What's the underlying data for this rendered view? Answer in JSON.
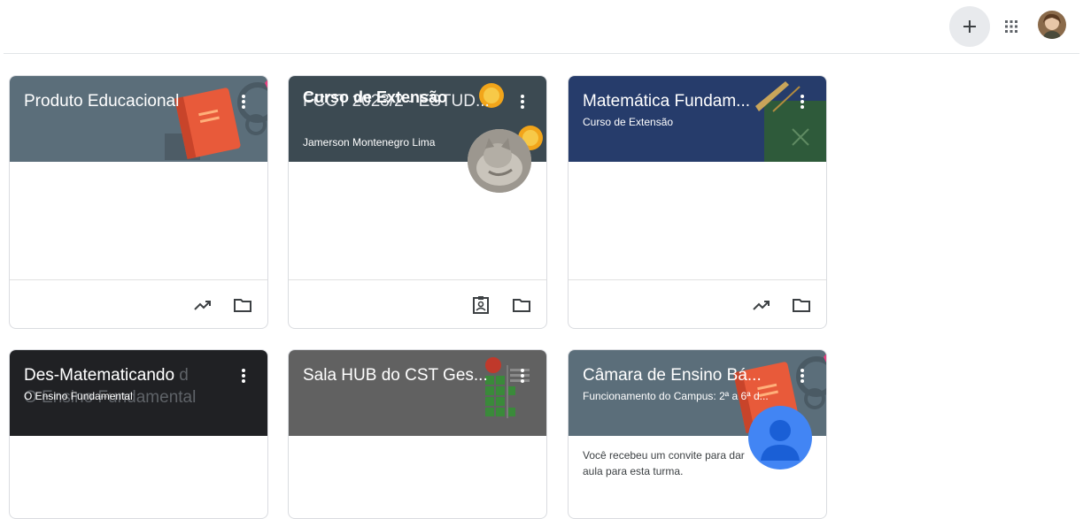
{
  "topbar": {
    "create_icon": "plus-icon",
    "apps_icon": "apps-grid-icon",
    "account_icon": "profile-avatar"
  },
  "cards": [
    {
      "title": "Produto Educacional",
      "subtitle": "",
      "teacher": "",
      "header_color": "#5b6e7a",
      "footer_icons": [
        "trending-up-icon",
        "folder-icon"
      ]
    },
    {
      "title": "FCCT 2023/2 - ESTUD...",
      "overlay_title": "Curso de Extensão",
      "subtitle": "",
      "teacher": "Jamerson Montenegro Lima",
      "header_color": "#3c4a52",
      "footer_icons": [
        "assignment-ind-icon",
        "folder-icon"
      ]
    },
    {
      "title": "Matemática Fundam...",
      "subtitle": "Curso de Extensão",
      "teacher": "",
      "header_color": "#263c6b",
      "footer_icons": [
        "trending-up-icon",
        "folder-icon"
      ]
    },
    {
      "title": "Des-Matematicando",
      "ghost_title": "Des-Matematicando d",
      "subtitle": "O Ensino Fundamental",
      "ghost_subtitle": "O Ensino Fundamental",
      "teacher": "",
      "header_color": "#202124",
      "footer_icons": []
    },
    {
      "title": "Sala HUB do CST Ges...",
      "subtitle": "",
      "teacher": "",
      "header_color": "#616161",
      "footer_icons": []
    },
    {
      "title": "Câmara de Ensino Bá...",
      "subtitle": "Funcionamento do Campus: 2ª a 6ª d...",
      "teacher": "",
      "header_color": "#5b6e7a",
      "invite": "Você recebeu um convite para dar aula para esta turma.",
      "footer_icons": []
    }
  ]
}
